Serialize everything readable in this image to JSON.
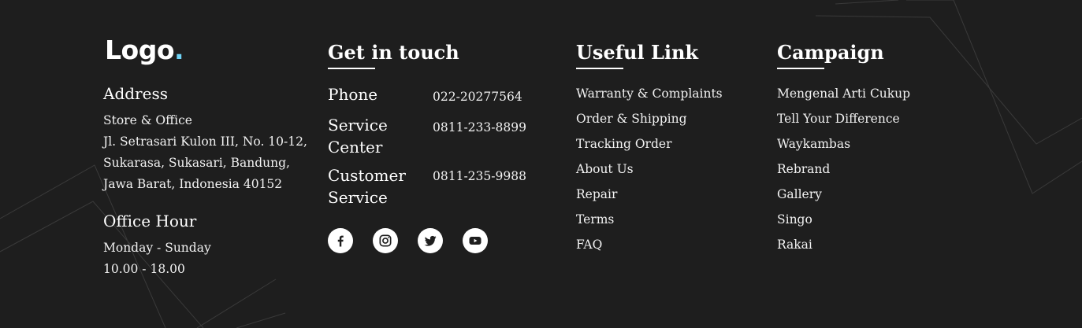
{
  "brand": {
    "logo_text": "Logo",
    "logo_dot": ".",
    "accent_color": "#6fd3f5"
  },
  "address": {
    "title": "Address",
    "lines": [
      "Store & Office",
      "Jl. Setrasari Kulon III, No. 10-12,",
      "Sukarasa, Sukasari, Bandung,",
      "Jawa Barat, Indonesia 40152"
    ]
  },
  "office_hour": {
    "title": "Office Hour",
    "days": "Monday - Sunday",
    "hours": "10.00 - 18.00"
  },
  "contact": {
    "title": "Get in touch",
    "rows": [
      {
        "label_1": "Phone",
        "label_2": "",
        "value": "022-20277564"
      },
      {
        "label_1": "Service",
        "label_2": "Center",
        "value": "0811-233-8899"
      },
      {
        "label_1": "Customer",
        "label_2": "Service",
        "value": "0811-235-9988"
      }
    ],
    "social": [
      "facebook-icon",
      "instagram-icon",
      "twitter-icon",
      "youtube-icon"
    ]
  },
  "useful_links": {
    "title": "Useful Link",
    "items": [
      "Warranty & Complaints",
      "Order & Shipping",
      "Tracking Order",
      "About Us",
      "Repair",
      "Terms",
      "FAQ"
    ]
  },
  "campaign": {
    "title": "Campaign",
    "items": [
      "Mengenal Arti Cukup",
      "Tell Your Difference",
      "Waykambas",
      "Rebrand",
      "Gallery",
      "Singo",
      "Rakai"
    ]
  }
}
